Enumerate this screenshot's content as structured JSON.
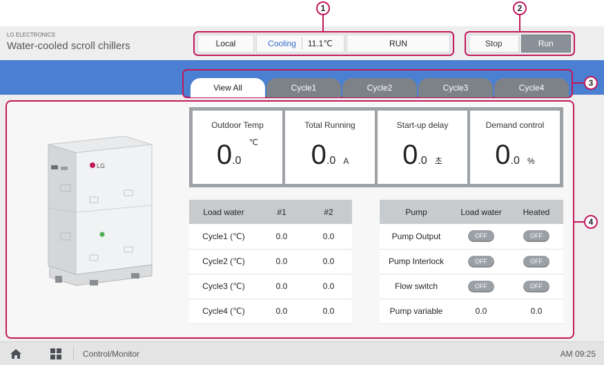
{
  "callouts": [
    "1",
    "2",
    "3",
    "4"
  ],
  "header": {
    "brand": "LG ELECTRONICS",
    "title": "Water-cooled scroll chillers"
  },
  "status": {
    "location": "Local",
    "mode": "Cooling",
    "temperature": "11.1℃",
    "state": "RUN"
  },
  "controls": {
    "stop": "Stop",
    "run": "Run"
  },
  "tabs": [
    "View All",
    "Cycle1",
    "Cycle2",
    "Cycle3",
    "Cycle4"
  ],
  "metrics": [
    {
      "label": "Outdoor Temp",
      "int": "0",
      "dec": ".0",
      "unit": "℃"
    },
    {
      "label": "Total Running",
      "int": "0",
      "dec": ".0",
      "unit": "A"
    },
    {
      "label": "Start-up delay",
      "int": "0",
      "dec": ".0",
      "unit": "초"
    },
    {
      "label": "Demand control",
      "int": "0",
      "dec": ".0",
      "unit": "%"
    }
  ],
  "load_water_table": {
    "headers": [
      "Load water",
      "#1",
      "#2"
    ],
    "rows": [
      [
        "Cycle1 (℃)",
        "0.0",
        "0.0"
      ],
      [
        "Cycle2 (℃)",
        "0.0",
        "0.0"
      ],
      [
        "Cycle3 (℃)",
        "0.0",
        "0.0"
      ],
      [
        "Cycle4 (℃)",
        "0.0",
        "0.0"
      ]
    ]
  },
  "pump_table": {
    "headers": [
      "Pump",
      "Load water",
      "Heated"
    ],
    "rows": [
      [
        "Pump Output",
        "OFF",
        "OFF"
      ],
      [
        "Pump Interlock",
        "OFF",
        "OFF"
      ],
      [
        "Flow switch",
        "OFF",
        "OFF"
      ],
      [
        "Pump variable",
        "0.0",
        "0.0"
      ]
    ]
  },
  "taskbar": {
    "label": "Control/Monitor",
    "time": "AM 09:25"
  },
  "device_logo": "LG",
  "colors": {
    "accent": "#c2185b",
    "band": "#4a7fd1",
    "mode": "#2e6bc6",
    "run": "#4a9d1c"
  }
}
